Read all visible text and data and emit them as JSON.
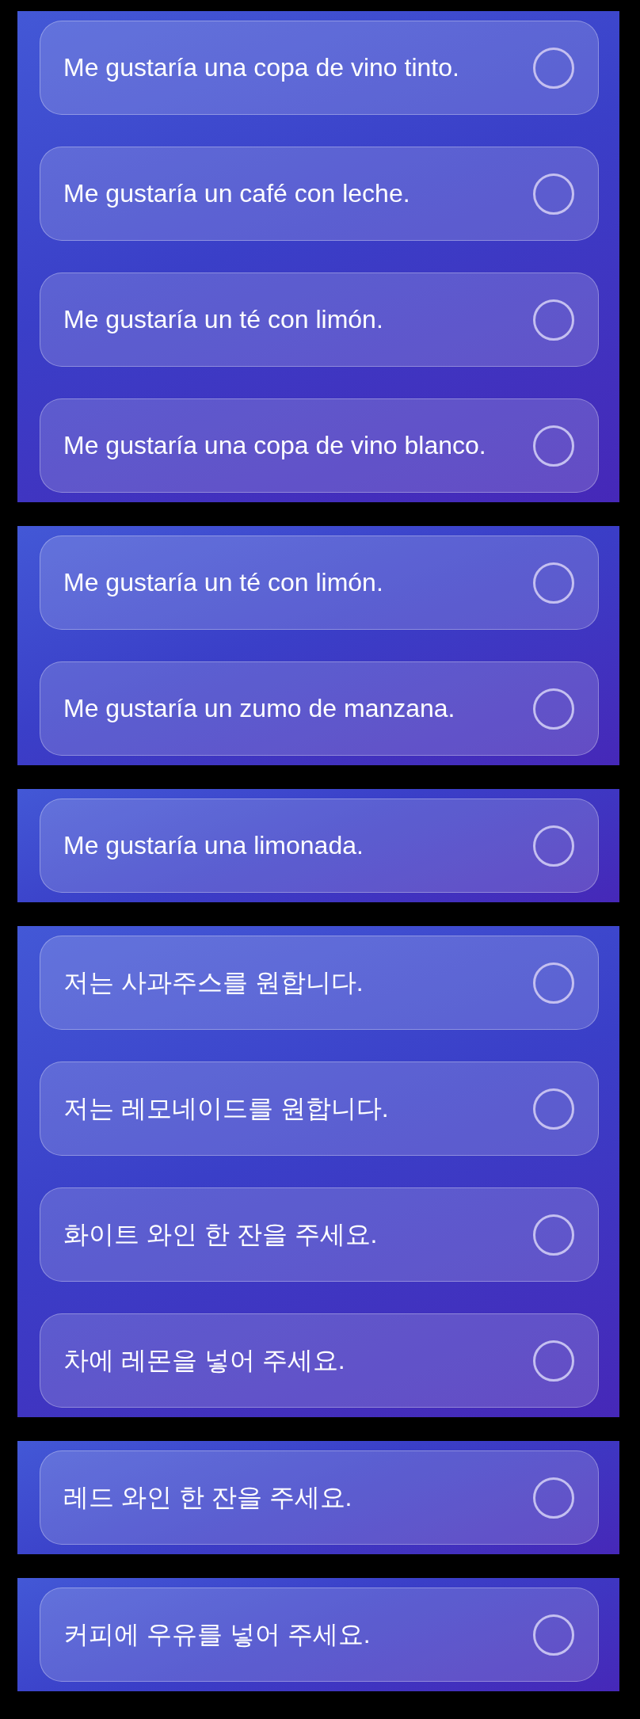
{
  "panels": [
    {
      "options": [
        {
          "text": "Me gustaría una copa de vino tinto.",
          "selected": false
        },
        {
          "text": "Me gustaría un café con leche.",
          "selected": false
        },
        {
          "text": "Me gustaría un té con limón.",
          "selected": false
        },
        {
          "text": "Me gustaría una copa de vino blanco.",
          "selected": false
        }
      ]
    },
    {
      "options": [
        {
          "text": "Me gustaría un té con limón.",
          "selected": false
        },
        {
          "text": "Me gustaría un zumo de manzana.",
          "selected": false
        }
      ]
    },
    {
      "options": [
        {
          "text": "Me gustaría una limonada.",
          "selected": false
        }
      ]
    },
    {
      "options": [
        {
          "text": "저는 사과주스를 원합니다.",
          "selected": false
        },
        {
          "text": "저는 레모네이드를 원합니다.",
          "selected": false
        },
        {
          "text": "화이트 와인 한 잔을 주세요.",
          "selected": false
        },
        {
          "text": "차에 레몬을 넣어 주세요.",
          "selected": false
        }
      ]
    },
    {
      "options": [
        {
          "text": "레드 와인 한 잔을 주세요.",
          "selected": false
        }
      ]
    },
    {
      "options": [
        {
          "text": "커피에 우유를 넣어 주세요.",
          "selected": false
        }
      ]
    }
  ]
}
